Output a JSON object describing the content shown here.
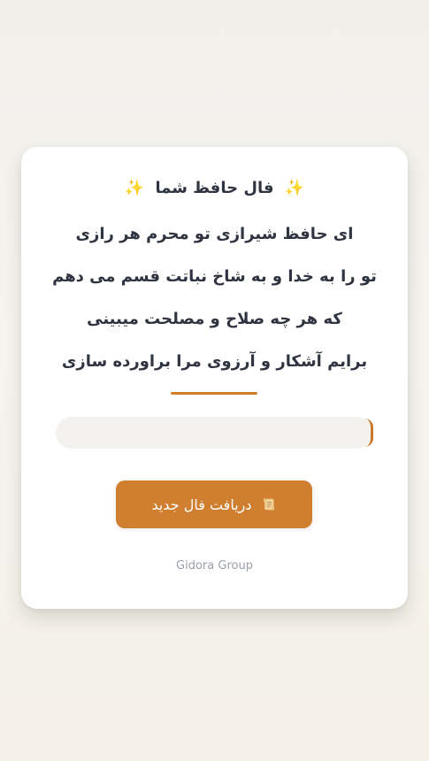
{
  "card": {
    "title_text": "فال حافظ شما",
    "poem": [
      "ای حافظ شیرازی تو محرم هر رازی",
      "تو را به خدا و به شاخ نباتت قسم می دهم",
      "که هر چه صلاح و مصلحت میبینی",
      "برایم آشکار و آرزوی مرا براورده سازی"
    ],
    "button_label": "دریافت فال جدید",
    "footer_text": "Gidora Group"
  },
  "icons": {
    "title_left": "sparkles-icon",
    "title_right": "sparkles-icon",
    "button": "scroll-icon"
  },
  "colors": {
    "accent": "#cf7f2f",
    "text": "#2f3440",
    "muted": "#9aa0a9",
    "card": "#ffffff"
  }
}
